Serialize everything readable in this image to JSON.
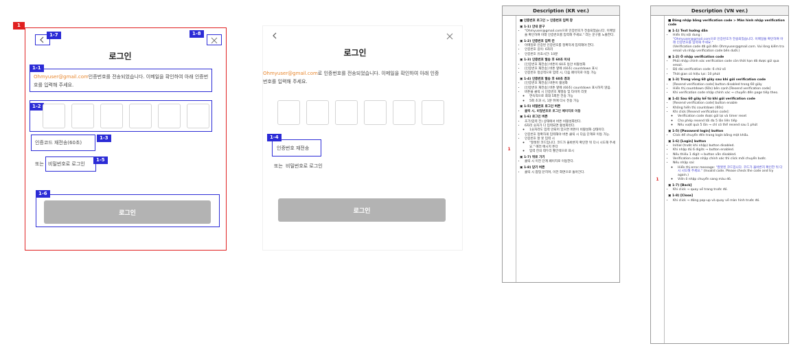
{
  "screen1": {
    "badge": "1",
    "title": "로그인",
    "email": "Ohmyuser@gmail.com",
    "message_suffix": "인증번호를 전송되었습니다. 이메일을 확인하여 아래 인증번호를 입력해 주세요.",
    "resend_label": "인증코드 재전송(60초)",
    "or_label": "또는",
    "password_login_label": "비밀번호로 로그인",
    "login_button": "로그인",
    "tags": {
      "t11": "1-1",
      "t12": "1-2",
      "t13": "1-3",
      "t15": "1-5",
      "t16": "1-6",
      "t17": "1-7",
      "t18": "1-8"
    }
  },
  "screen2": {
    "title": "로그인",
    "email": "Ohmyuser@gmail.com",
    "message_suffix": "로 인증번호를 전송되었습니다. 이메일을 확인하여 아래 인증번호를 입력해 주세요.",
    "resend_label": "인증번호 재전송",
    "or_label": "또는",
    "password_login_label": "비밀번호로 로그인",
    "login_button": "로그인",
    "tags": {
      "t14": "1-4"
    }
  },
  "colors": {
    "accent_orange": "#e8862c",
    "annotation_blue": "#2b2bd6",
    "annotation_red": "#e02020",
    "disabled_button": "#b3b3b3"
  },
  "icons": {
    "back": "chevron-left-icon",
    "close": "close-icon"
  },
  "desc_kr": {
    "header": "Description (KR ver.)",
    "num": "1",
    "title": "■ 인증번호 로그인 > 인증번호 입력 창",
    "s1": "▣ 1-1) 안내 문구",
    "s1_i1": "\"Ohmyuser@gmail.com으로 인증번호가 전송되었습니다. 이메일을 확인하여 아래 인증번호를 입력해 주세요.\" 라는 문구를 노출한다.",
    "s2": "▣ 1-2) 인증번호 입력 칸",
    "s2_i1": "이메일로 인증된 인증번호를 정확하게 입력해야 한다.",
    "s2_i2": "인증번호 길이: 6자리",
    "s2_i3": "인증번호 유효시간: 10분",
    "s3": "▣ 1-3) 인증번호 발송 후 60초 이내",
    "s3_i1": "[인증번호 재전송] 버튼이 60초 동안 비활성화",
    "s3_i2": "[인증번호 재전송] 버튼 옆에 (60초) countdown 표시",
    "s3_i3": "인증번호 정상적으로 입력 시, 다음 페이지로 이동 가능",
    "s4": "▣ 1-4) 인증번호 발송 후 60초 경과",
    "s4_i1": "[인증번호 재전송] 버튼이 활성화",
    "s4_i2": "[인증번호 재전송] 버튼 옆에 (60초) countdown 표시하지 않음.",
    "s4_i3": "버튼을 클릭 시 인증번호 재발송 및 타이머 리셋",
    "s4_i3a": "연속적으로 최대 5회만 전송 가능",
    "s4_i3b": "5회 초과 시, 1분 뒤에 다시 전송 가능",
    "s5": "▣ 1-5) 비밀번호 로그인 버튼",
    "s5_i1": "클릭 시, 비밀번호로 로그인 페이지로 이동",
    "s6": "▣ 1-6) 로그인 버튼",
    "s6_i1": "초기(입력 전) 상태에서 버튼 비활성화된다.",
    "s6_i2": "6자리 숫자가 다 입력되면 활성화된다.",
    "s6_i2a": "1숫자라도 입력 안되어 있으면 버튼이 비활성화 상태이다.",
    "s6_i3": "인증번호 정확하게 입력해야 버튼 클릭 시 다음 단계로 이동 가능.",
    "s6_i4": "인증번호 잘 못 입력 시",
    "s6_i4a": "\"잘못된 코드입니다. 코드가 올바른지 확인한 뒤 다시 시도해 주세요.\" 에러 메시지 뜬다",
    "s6_i4b": "입력 칸의 테두리 빨간색으로 표시",
    "s7": "▣ 1-7) 뒤로 가기",
    "s7_i1": "클릭 시 이전 단계 페이지로 이동한다.",
    "s8": "▣ 1-8) 닫기 버튼",
    "s8_i1": "클릭 시 팝업 닫히며, 이전 화면으로 돌아간다."
  },
  "desc_vn": {
    "header": "Description (VN ver.)",
    "num": "1",
    "title": "■ Đăng nhập bằng verification code > Màn hình nhập verification code",
    "s1": "▣ 1-1) Text hướng dẫn",
    "s1_i1": "Hiển thị nội dung :",
    "s1_i1q": "\"Ohmyuser@gmail.com으로 인증번호가 전송되었습니다. 이메일을 확인하여 아래 인증번호를 입력해 주세요.\"",
    "s1_i1r": "(Verification code đã gửi đến Ohmyuser@gmail.com. Vui lòng kiểm tra email và nhập verification code bên dưới.)",
    "s2": "▣ 1-2) Ô nhập verification code",
    "s2_i1": "Phải nhập chính xác verification code còn thời hạn đã được gửi qua email.",
    "s2_i2": "Độ dài verification code: 6 chữ số",
    "s2_i3": "Thời gian có hiệu lực: 10 phút",
    "s3": "▣ 1-3) Trong vòng 60 giây sau khi gửi verification code",
    "s3_i1": "[Resend verification code] button disabled trong 60 giây",
    "s3_i2": "Hiển thị countdown (60s) bên cạnh [Resend verification code]",
    "s3_i3": "Khi verification code nhập chính xác → chuyển đến page tiếp theo.",
    "s4": "▣ 1-4)  Sau 60 giây kể từ khi gửi verification code",
    "s4_i1": "[Resend verification code] button enable",
    "s4_i2": "Không hiển thị countdown (60s)",
    "s4_i3": "Khi click [Resend verification code]:",
    "s4_i3a": "Verification code được gửi lại và timer reset",
    "s4_i3b": "Cho phép resend tối đa 5 lần liên tiếp",
    "s4_i3c": "Nếu vượt quá 5 lần → chỉ có thể resend sau 1 phút",
    "s5": "▣ 1-5) [Password login] button",
    "s5_i1": "Click để chuyển đến trang login bằng mật khẩu.",
    "s6": "▣ 1-6) [Login] button",
    "s6_i1": "Initial (trước khi nhập) button disabled.",
    "s6_i2": "Khi nhập đủ 6 digits → button enabled.",
    "s6_i3": "Nếu thiếu 1 digit → button vẫn disabled.",
    "s6_i4": "Verification code nhập chính xác thì click mới chuyển bước.",
    "s6_i5": "Nếu nhập sai:",
    "s6_i5a": "Hiển thị error message:",
    "s6_i5aq": "\"잘못된 코드입니다. 코드가 올바른지 확인한 뒤 다시 시도해 주세요.\"",
    "s6_i5ar": "(Invalid code. Please check the code and try again.)",
    "s6_i5b": "Viền ô nhập chuyển sang màu đỏ.",
    "s7": "▣ 1-7) [Back]",
    "s7_i1": "Khi click → quay về trang trước đó.",
    "s8": "▣ 1-8) [Close]",
    "s8_i1": "Khi click → đóng pop-up và quay về màn hình trước đó."
  }
}
